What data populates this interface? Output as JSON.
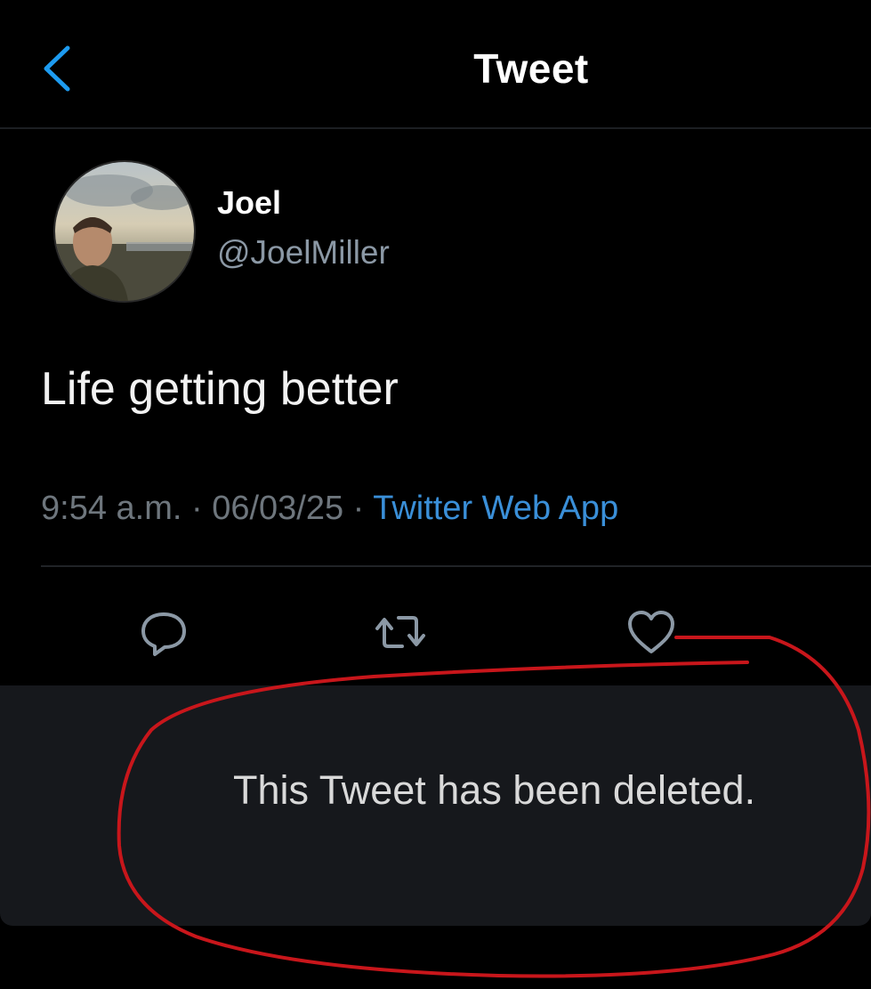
{
  "header": {
    "title": "Tweet",
    "back_icon": "chevron-left-icon",
    "back_color": "#1d9bf0"
  },
  "tweet": {
    "author": {
      "name": "Joel",
      "handle": "@JoelMiller"
    },
    "text": "Life getting better",
    "time": "9:54 a.m.",
    "separator": " · ",
    "date": "06/03/25",
    "source": "Twitter Web App",
    "source_color": "#3a8fd8",
    "actions": [
      {
        "name": "reply",
        "icon": "comment-icon"
      },
      {
        "name": "retweet",
        "icon": "retweet-icon"
      },
      {
        "name": "like",
        "icon": "heart-icon"
      }
    ]
  },
  "deleted_notice": {
    "text": "This Tweet has been deleted."
  },
  "annotation": {
    "shape": "hand-drawn-circle",
    "color": "#c8161b"
  }
}
